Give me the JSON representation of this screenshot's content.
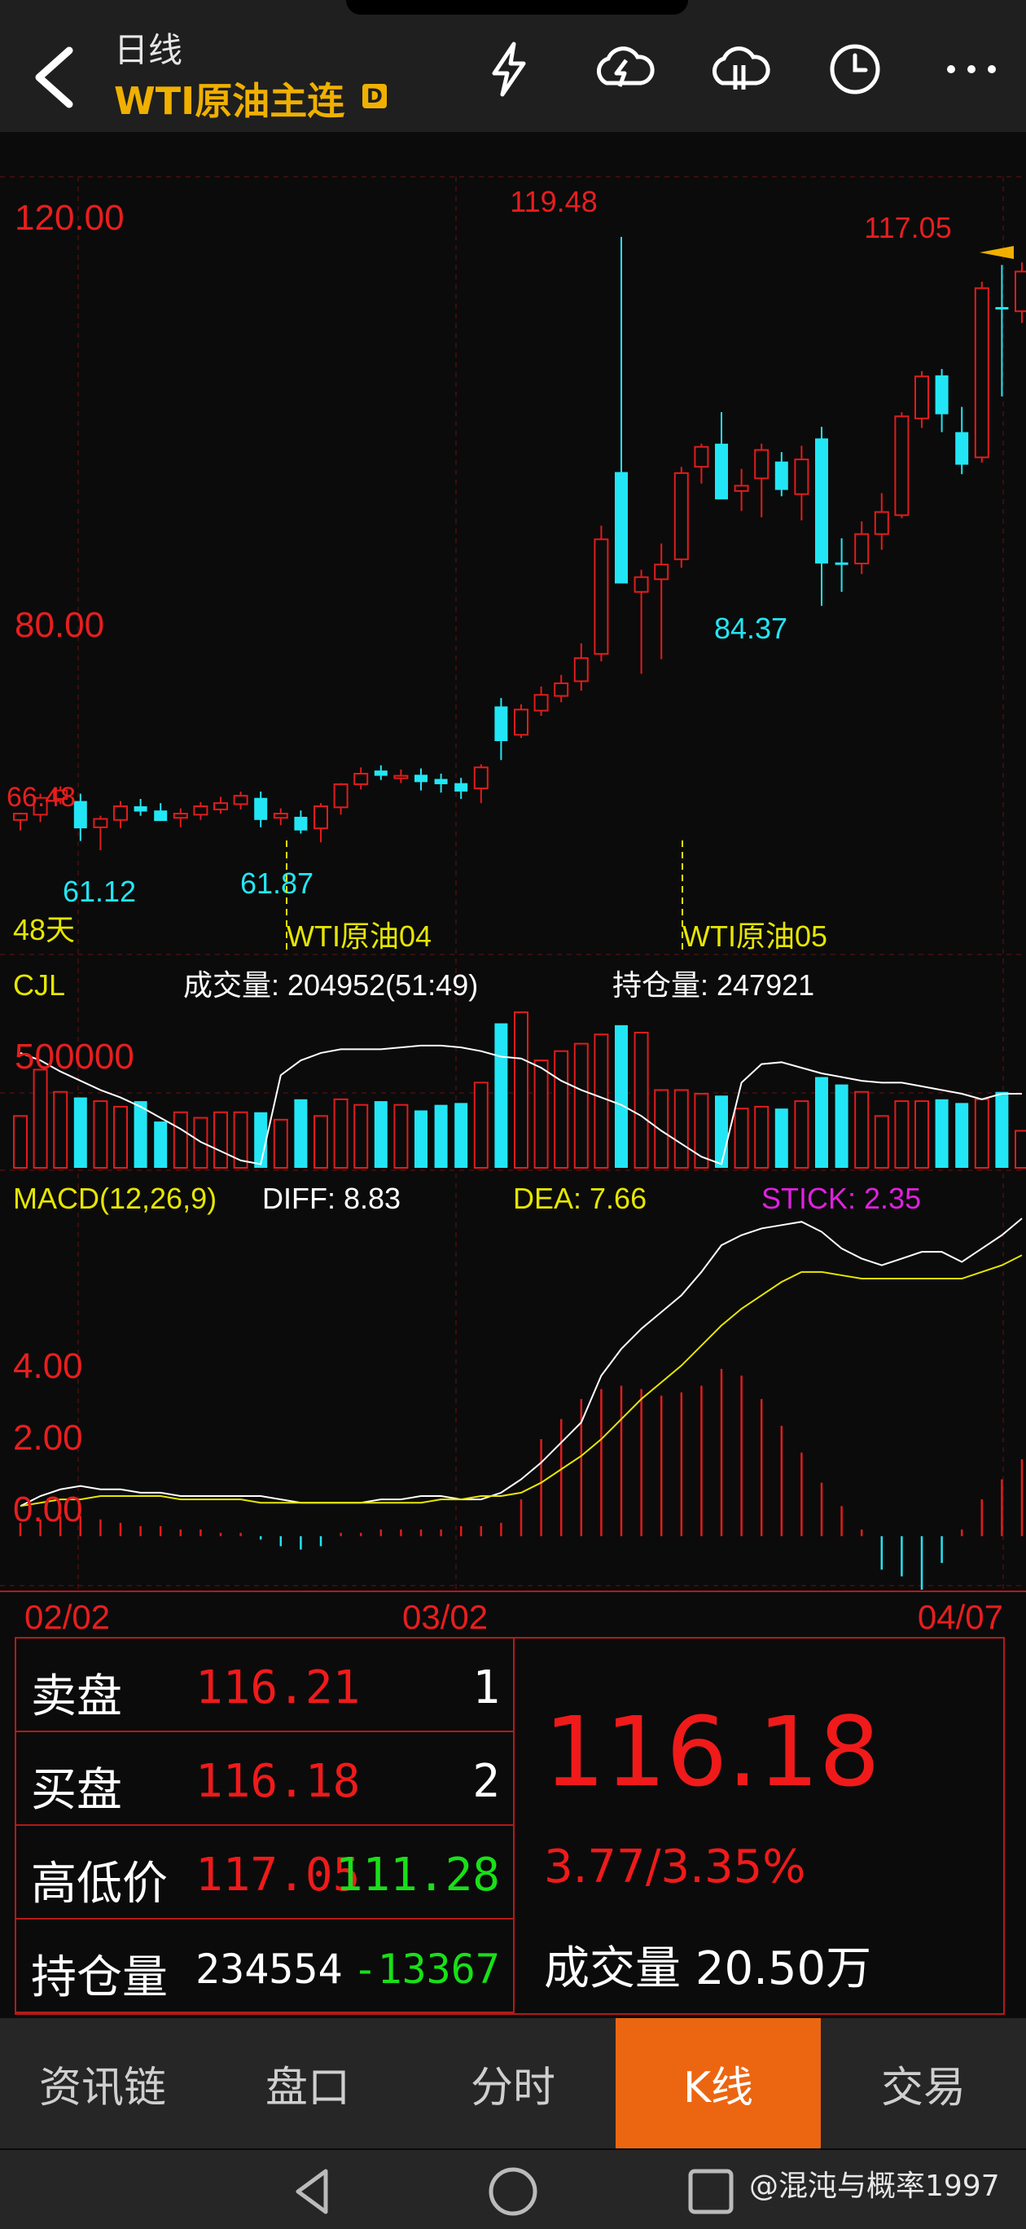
{
  "header": {
    "period": "日线",
    "title": "WTI原油主连",
    "badge": "D",
    "icons": [
      "back-arrow-icon",
      "lightning-icon",
      "cloud-upload-icon",
      "cloud-download-icon",
      "clock-icon",
      "more-icon"
    ]
  },
  "chart_data": {
    "type": "candlestick",
    "colors": {
      "up": "#e11c1c",
      "down": "#22e6f5",
      "ma_white": "#ffffff",
      "ma_yellow": "#e6e600"
    },
    "price_axis": {
      "labels": [
        "120.00",
        "80.00"
      ],
      "ylim": [
        51.2,
        125.2
      ]
    },
    "annotations": {
      "high": "119.48",
      "last_high": "117.05",
      "left_top": "66.48",
      "low1": "61.12",
      "low2": "61.87",
      "low3": "84.37"
    },
    "days_label": "48天",
    "contract_labels": [
      "WTI原油04",
      "WTI原油05"
    ],
    "candles": [
      {
        "o": 64.0,
        "h": 64.7,
        "l": 63.0,
        "c": 64.6
      },
      {
        "o": 64.5,
        "h": 66.5,
        "l": 63.8,
        "c": 66.1
      },
      {
        "o": 66.0,
        "h": 67.2,
        "l": 65.5,
        "c": 66.8
      },
      {
        "o": 65.8,
        "h": 66.5,
        "l": 62.0,
        "c": 63.2
      },
      {
        "o": 63.3,
        "h": 64.4,
        "l": 61.12,
        "c": 64.1
      },
      {
        "o": 64.0,
        "h": 65.8,
        "l": 63.2,
        "c": 65.3
      },
      {
        "o": 65.3,
        "h": 66.0,
        "l": 64.4,
        "c": 64.8
      },
      {
        "o": 64.9,
        "h": 65.6,
        "l": 63.9,
        "c": 63.9
      },
      {
        "o": 64.2,
        "h": 65.1,
        "l": 63.3,
        "c": 64.6
      },
      {
        "o": 64.5,
        "h": 65.7,
        "l": 64.0,
        "c": 65.3
      },
      {
        "o": 65.0,
        "h": 66.2,
        "l": 64.6,
        "c": 65.6
      },
      {
        "o": 65.5,
        "h": 66.7,
        "l": 65.0,
        "c": 66.3
      },
      {
        "o": 66.1,
        "h": 66.7,
        "l": 63.3,
        "c": 64.0
      },
      {
        "o": 64.2,
        "h": 65.1,
        "l": 63.5,
        "c": 64.6
      },
      {
        "o": 64.3,
        "h": 64.9,
        "l": 62.7,
        "c": 63.0
      },
      {
        "o": 63.2,
        "h": 65.6,
        "l": 61.87,
        "c": 65.3
      },
      {
        "o": 65.2,
        "h": 67.5,
        "l": 64.5,
        "c": 67.4
      },
      {
        "o": 67.4,
        "h": 69.0,
        "l": 66.9,
        "c": 68.4
      },
      {
        "o": 68.7,
        "h": 69.2,
        "l": 67.8,
        "c": 68.2
      },
      {
        "o": 68.1,
        "h": 68.8,
        "l": 67.5,
        "c": 68.2
      },
      {
        "o": 68.3,
        "h": 68.9,
        "l": 66.8,
        "c": 67.6
      },
      {
        "o": 67.9,
        "h": 68.4,
        "l": 66.6,
        "c": 67.4
      },
      {
        "o": 67.5,
        "h": 68.0,
        "l": 66.0,
        "c": 66.7
      },
      {
        "o": 67.0,
        "h": 69.3,
        "l": 65.6,
        "c": 69.0
      },
      {
        "o": 74.8,
        "h": 75.6,
        "l": 69.7,
        "c": 71.5
      },
      {
        "o": 72.1,
        "h": 75.0,
        "l": 71.8,
        "c": 74.5
      },
      {
        "o": 74.4,
        "h": 76.7,
        "l": 73.9,
        "c": 75.9
      },
      {
        "o": 75.8,
        "h": 77.8,
        "l": 75.2,
        "c": 77.0
      },
      {
        "o": 77.2,
        "h": 80.8,
        "l": 76.3,
        "c": 79.4
      },
      {
        "o": 79.8,
        "h": 92.0,
        "l": 79.1,
        "c": 90.7
      },
      {
        "o": 97.1,
        "h": 119.48,
        "l": 86.6,
        "c": 86.5
      },
      {
        "o": 85.7,
        "h": 87.8,
        "l": 77.9,
        "c": 87.1
      },
      {
        "o": 86.9,
        "h": 90.3,
        "l": 79.3,
        "c": 88.3
      },
      {
        "o": 88.8,
        "h": 97.6,
        "l": 88.0,
        "c": 97.0
      },
      {
        "o": 97.6,
        "h": 99.8,
        "l": 96.0,
        "c": 99.5
      },
      {
        "o": 99.8,
        "h": 102.8,
        "l": 95.0,
        "c": 94.5
      },
      {
        "o": 95.3,
        "h": 97.4,
        "l": 93.4,
        "c": 95.8
      },
      {
        "o": 96.5,
        "h": 99.8,
        "l": 92.8,
        "c": 99.2
      },
      {
        "o": 98.1,
        "h": 99.0,
        "l": 94.8,
        "c": 95.4
      },
      {
        "o": 95.0,
        "h": 99.6,
        "l": 92.5,
        "c": 98.3
      },
      {
        "o": 100.3,
        "h": 101.4,
        "l": 84.37,
        "c": 88.4
      },
      {
        "o": 88.5,
        "h": 90.8,
        "l": 85.7,
        "c": 88.3
      },
      {
        "o": 88.4,
        "h": 92.4,
        "l": 87.4,
        "c": 91.2
      },
      {
        "o": 91.2,
        "h": 95.1,
        "l": 89.7,
        "c": 93.3
      },
      {
        "o": 93.0,
        "h": 102.8,
        "l": 92.7,
        "c": 102.4
      },
      {
        "o": 102.2,
        "h": 106.7,
        "l": 101.3,
        "c": 106.2
      },
      {
        "o": 106.3,
        "h": 106.9,
        "l": 100.9,
        "c": 102.6
      },
      {
        "o": 100.9,
        "h": 103.3,
        "l": 96.9,
        "c": 97.8
      },
      {
        "o": 98.5,
        "h": 115.2,
        "l": 98.0,
        "c": 114.6
      },
      {
        "o": 112.8,
        "h": 116.8,
        "l": 104.3,
        "c": 112.6
      },
      {
        "o": 112.4,
        "h": 117.05,
        "l": 111.28,
        "c": 116.18
      }
    ],
    "volume": {
      "label": "CJL",
      "volume_text": "成交量: 204952(51:49)",
      "oi_text": "持仓量: 247921",
      "axis_label": "500000",
      "ylim": [
        0,
        800000
      ],
      "values": [
        280000,
        530000,
        410000,
        380000,
        360000,
        330000,
        360000,
        250000,
        300000,
        270000,
        300000,
        300000,
        300000,
        260000,
        370000,
        280000,
        370000,
        340000,
        360000,
        340000,
        310000,
        340000,
        350000,
        460000,
        780000,
        840000,
        580000,
        630000,
        670000,
        720000,
        770000,
        730000,
        420000,
        420000,
        400000,
        390000,
        320000,
        330000,
        320000,
        360000,
        490000,
        450000,
        410000,
        280000,
        360000,
        360000,
        370000,
        350000,
        370000,
        410000,
        200000
      ],
      "line": [
        620000,
        580000,
        520000,
        470000,
        420000,
        380000,
        330000,
        270000,
        210000,
        140000,
        90000,
        40000,
        20000,
        500000,
        580000,
        620000,
        640000,
        640000,
        640000,
        650000,
        660000,
        660000,
        650000,
        630000,
        600000,
        590000,
        540000,
        470000,
        420000,
        380000,
        340000,
        280000,
        200000,
        130000,
        60000,
        20000,
        460000,
        560000,
        570000,
        540000,
        510000,
        490000,
        470000,
        460000,
        460000,
        440000,
        420000,
        400000,
        370000,
        400000,
        400000
      ]
    },
    "macd": {
      "label": "MACD(12,26,9)",
      "diff_text": "DIFF: 8.83",
      "dea_text": "DEA: 7.66",
      "stick_text": "STICK: 2.35",
      "axis_labels": [
        "4.00",
        "2.00",
        "0.00"
      ],
      "ylim": [
        -1.6,
        9.6
      ],
      "diff": [
        0.9,
        1.2,
        1.4,
        1.5,
        1.4,
        1.4,
        1.3,
        1.3,
        1.2,
        1.2,
        1.2,
        1.2,
        1.2,
        1.1,
        1.0,
        1.0,
        1.0,
        1.0,
        1.1,
        1.1,
        1.2,
        1.2,
        1.1,
        1.1,
        1.3,
        1.7,
        2.2,
        2.8,
        3.4,
        4.8,
        5.6,
        6.2,
        6.7,
        7.2,
        7.9,
        8.7,
        9.0,
        9.2,
        9.3,
        9.4,
        9.1,
        8.6,
        8.3,
        8.1,
        8.3,
        8.5,
        8.5,
        8.2,
        8.6,
        9.0,
        9.5
      ],
      "dea": [
        0.9,
        1.0,
        1.1,
        1.1,
        1.2,
        1.2,
        1.2,
        1.2,
        1.1,
        1.1,
        1.1,
        1.1,
        1.0,
        1.0,
        1.0,
        1.0,
        1.0,
        1.0,
        1.0,
        1.0,
        1.0,
        1.1,
        1.1,
        1.2,
        1.2,
        1.3,
        1.6,
        2.0,
        2.4,
        2.9,
        3.5,
        4.1,
        4.6,
        5.1,
        5.7,
        6.3,
        6.8,
        7.2,
        7.6,
        7.9,
        7.9,
        7.8,
        7.7,
        7.7,
        7.7,
        7.7,
        7.7,
        7.7,
        7.9,
        8.1,
        8.4
      ],
      "stick": [
        0.4,
        0.5,
        0.6,
        0.6,
        0.5,
        0.4,
        0.3,
        0.3,
        0.2,
        0.2,
        0.1,
        0.1,
        -0.1,
        -0.3,
        -0.4,
        -0.3,
        0.1,
        0.1,
        0.2,
        0.2,
        0.2,
        0.2,
        0.3,
        0.3,
        0.4,
        1.1,
        2.9,
        3.5,
        4.1,
        4.4,
        4.5,
        4.4,
        4.2,
        4.3,
        4.5,
        5.0,
        4.8,
        4.1,
        3.3,
        2.5,
        1.6,
        0.9,
        0.2,
        -1.0,
        -1.2,
        -1.6,
        -0.8,
        0.2,
        1.1,
        1.7,
        2.3
      ]
    },
    "date_labels": [
      "02/02",
      "03/02",
      "04/07"
    ]
  },
  "quote": {
    "sell": {
      "label": "卖盘",
      "price": "116.21",
      "qty": "1"
    },
    "buy": {
      "label": "买盘",
      "price": "116.18",
      "qty": "2"
    },
    "highlow": {
      "label": "高低价",
      "high": "117.05",
      "low": "111.28"
    },
    "oi": {
      "label": "持仓量",
      "value": "234554",
      "change": "-13367"
    },
    "last": "116.18",
    "change": "3.77/3.35%",
    "volume_label": "成交量",
    "volume": "20.50万"
  },
  "tabs": [
    "资讯链",
    "盘口",
    "分时",
    "K线",
    "交易"
  ],
  "active_tab": "K线",
  "watermark": "@混沌与概率1997"
}
